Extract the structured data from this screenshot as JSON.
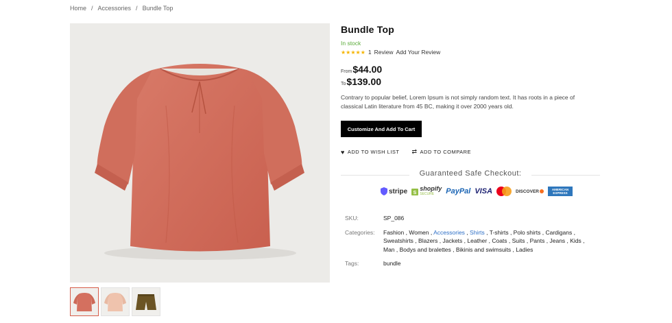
{
  "breadcrumb": [
    "Home",
    "Accessories",
    "Bundle Top"
  ],
  "product": {
    "title": "Bundle Top",
    "stock": "In stock",
    "review_count": "1",
    "review_label": "Review",
    "add_review": "Add Your Review",
    "price_from_label": "From",
    "price_from": "$44.00",
    "price_to_label": "To",
    "price_to": "$139.00",
    "description": "Contrary to popular belief, Lorem Ipsum is not simply random text. It has roots in a piece of classical Latin literature from 45 BC, making it over 2000 years old.",
    "cart_button": "Customize And Add To Cart",
    "wishlist": "ADD TO WISH LIST",
    "compare": "ADD TO COMPARE",
    "rating_stars": 5
  },
  "checkout": {
    "title": "Guaranteed Safe Checkout:",
    "payments": [
      "stripe",
      "shopify",
      "PayPal",
      "VISA",
      "mastercard",
      "DISCOVER",
      "AMERICAN EXPRESS"
    ],
    "shopify_sub": "SECURE"
  },
  "meta": {
    "sku_label": "SKU:",
    "sku": "SP_086",
    "categories_label": "Categories:",
    "categories": [
      "Fashion",
      "Women",
      "Accessories",
      "Shirts",
      "T-shirts",
      "Polo shirts",
      "Cardigans",
      "Sweatshirts",
      "Blazers",
      "Jackets",
      "Leather",
      "Coats",
      "Suits",
      "Pants",
      "Jeans",
      "Kids",
      "Man",
      "Bodys and bralettes",
      "Bikinis and swimsuits",
      "Ladies"
    ],
    "highlighted_categories": [
      "Accessories",
      "Shirts"
    ],
    "tags_label": "Tags:",
    "tags": "bundle"
  },
  "colors": {
    "in_stock": "#5bab3a",
    "star": "#f5b400",
    "link_highlight": "#2e6fc6",
    "top_main": "#d4705f",
    "thumb_top_2": "#efc3ad",
    "thumb_shorts": "#6b5424"
  }
}
